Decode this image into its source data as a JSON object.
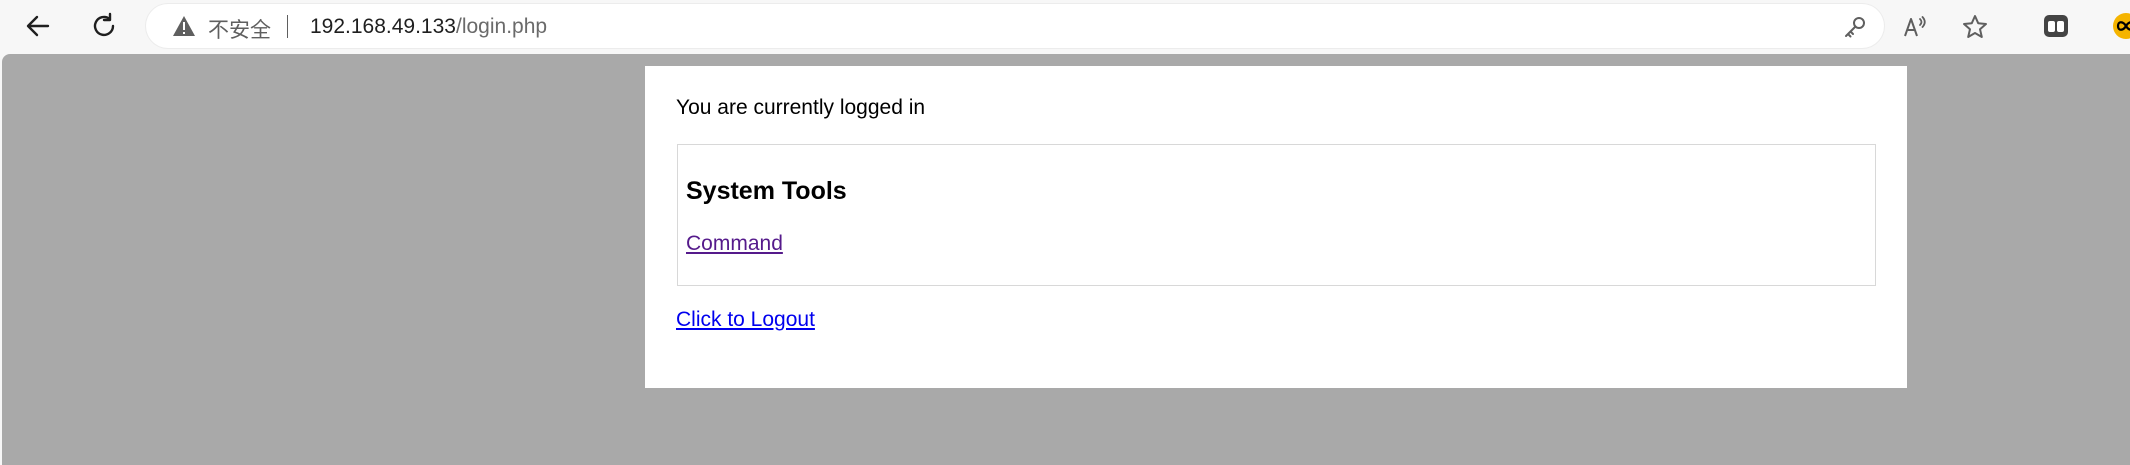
{
  "browser": {
    "security_label": "不安全",
    "url_host": "192.168.49.133",
    "url_path": "/login.php"
  },
  "page": {
    "status_text": "You are currently logged in",
    "tools": {
      "title": "System Tools",
      "links": [
        {
          "label": "Command"
        }
      ]
    },
    "logout_label": "Click to Logout"
  },
  "colors": {
    "page_background": "#a9a9a9",
    "panel_background": "#ffffff",
    "visited_link": "#551a8b",
    "link": "#0000ee"
  },
  "icons": {
    "back": "back-arrow-icon",
    "refresh": "refresh-icon",
    "warning": "warning-triangle-icon",
    "key": "key-icon",
    "read_aloud": "read-aloud-icon",
    "favorite": "star-icon",
    "extension_1": "tabs-extension-icon",
    "extension_2": "infinity-extension-icon"
  }
}
